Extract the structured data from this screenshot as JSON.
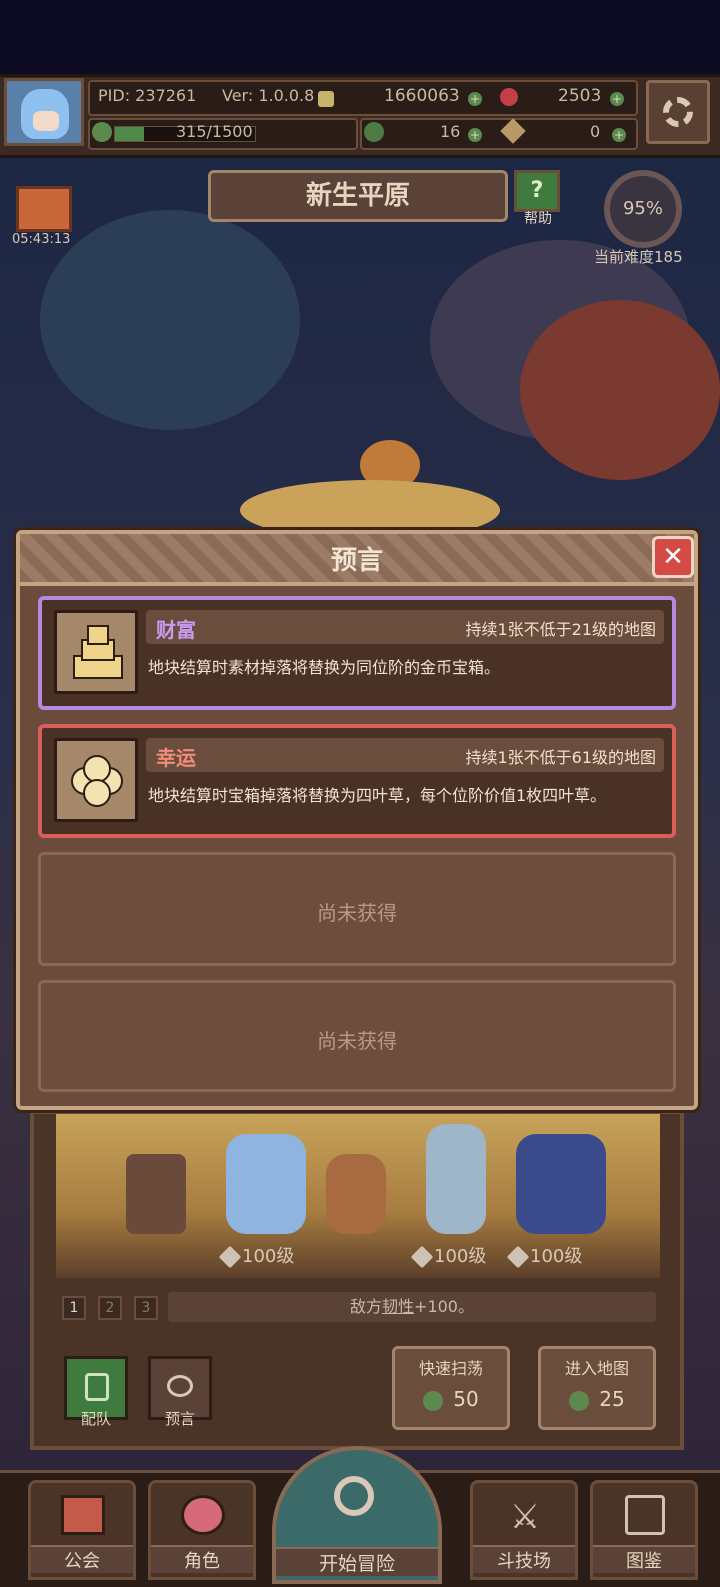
{
  "header": {
    "pid": "PID: 237261",
    "version": "Ver: 1.0.0.8",
    "gold": "1660063",
    "gems": "2503",
    "energy": "315/1500",
    "energy_fraction": 0.21,
    "clovers": "16",
    "keys": "0"
  },
  "map": {
    "title": "新生平原",
    "help_label": "帮助",
    "gift_timer": "05:43:13",
    "progress": "95%",
    "difficulty": "当前难度185"
  },
  "modal": {
    "title": "预言",
    "close_icon": "✕",
    "cards": [
      {
        "name": "财富",
        "condition": "持续1张不低于21级的地图",
        "description": "地块结算时素材掉落将替换为同位阶的金币宝箱。",
        "icon": "coin-stack-icon",
        "color": "#b689e0"
      },
      {
        "name": "幸运",
        "condition": "持续1张不低于61级的地图",
        "description": "地块结算时宝箱掉落将替换为四叶草，每个位阶价值1枚四叶草。",
        "icon": "four-leaf-clover-icon",
        "color": "#d9605a"
      }
    ],
    "empty_label_1": "尚未获得",
    "empty_label_2": "尚未获得"
  },
  "party": {
    "levels": [
      "100级",
      "100级",
      "100级"
    ],
    "tiers": [
      "1",
      "2",
      "3"
    ],
    "effect_prefix": "敌方",
    "effect_keyword": "韧性",
    "effect_suffix": "+100。",
    "team_label": "配队",
    "prophecy_label": "预言",
    "sweep_title": "快速扫荡",
    "sweep_cost": "50",
    "enter_title": "进入地图",
    "enter_cost": "25"
  },
  "nav": {
    "guild": "公会",
    "character": "角色",
    "start": "开始冒险",
    "arena": "斗技场",
    "codex": "图鉴"
  }
}
